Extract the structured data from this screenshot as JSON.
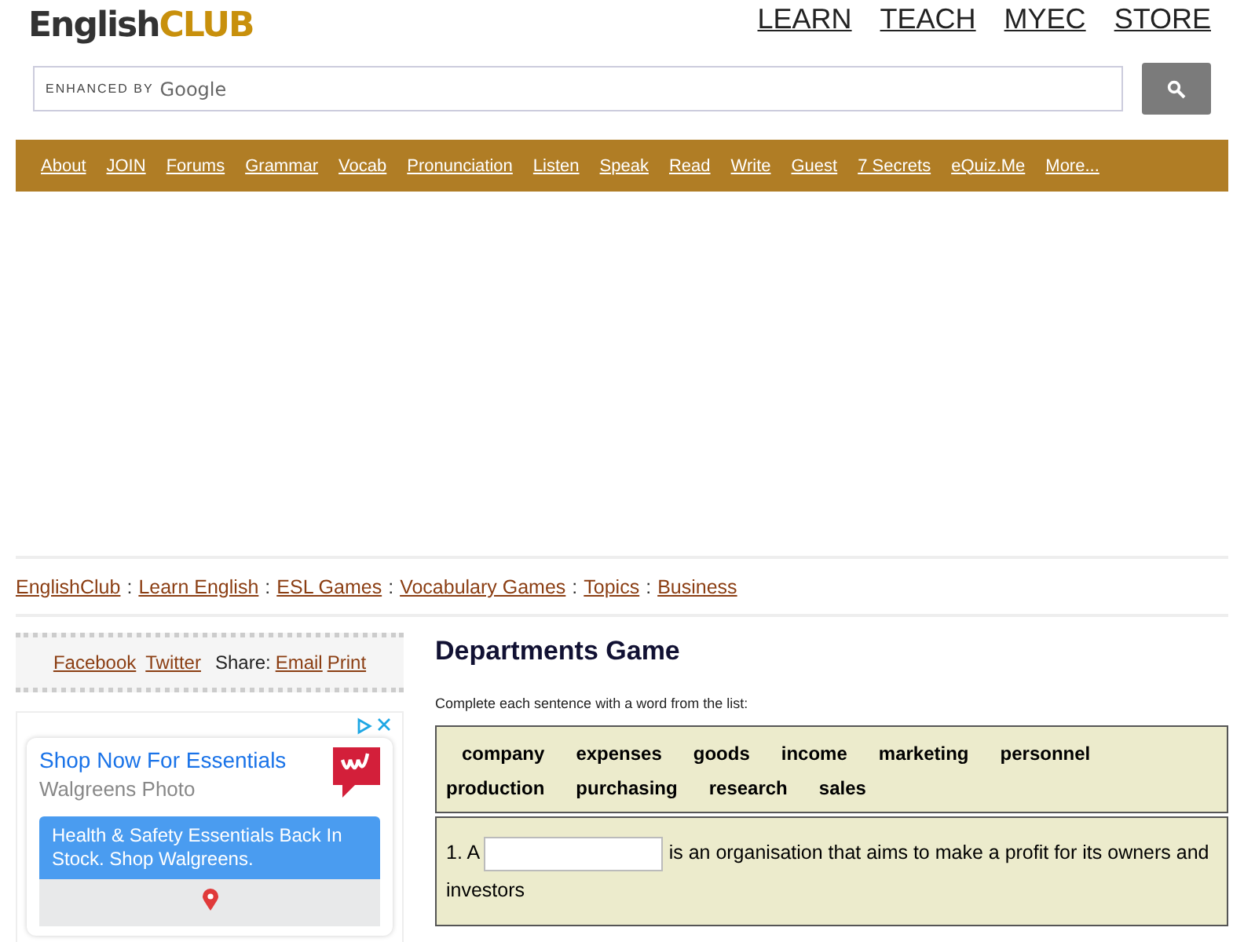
{
  "header": {
    "logo": {
      "first": "English",
      "second": "CLUB"
    },
    "top_links": [
      "LEARN",
      "TEACH",
      "MYEC",
      "STORE"
    ]
  },
  "search": {
    "branding_small": "ENHANCED BY",
    "branding": "Google"
  },
  "nav": [
    "About",
    "JOIN",
    "Forums",
    "Grammar",
    "Vocab",
    "Pronunciation",
    "Listen",
    "Speak",
    "Read",
    "Write",
    "Guest",
    "7 Secrets",
    "eQuiz.Me",
    "More..."
  ],
  "breadcrumb": {
    "separator": ":",
    "items": [
      "EnglishClub",
      "Learn English",
      "ESL Games",
      "Vocabulary Games",
      "Topics",
      "Business"
    ]
  },
  "share": {
    "links_before": [
      "Facebook",
      "Twitter"
    ],
    "label": "Share:",
    "links_after": [
      "Email",
      "Print"
    ]
  },
  "ad": {
    "title": "Shop Now For Essentials",
    "subtitle": "Walgreens Photo",
    "body": "Health & Safety Essentials Back In Stock. Shop Walgreens."
  },
  "game": {
    "title": "Departments Game",
    "instruction": "Complete each sentence with a word from the list:",
    "words": [
      "company",
      "expenses",
      "goods",
      "income",
      "marketing",
      "personnel",
      "production",
      "purchasing",
      "research",
      "sales"
    ],
    "questions": [
      {
        "before": "1. A",
        "after": "is an organisation that aims to make a profit for its owners and investors"
      }
    ]
  }
}
